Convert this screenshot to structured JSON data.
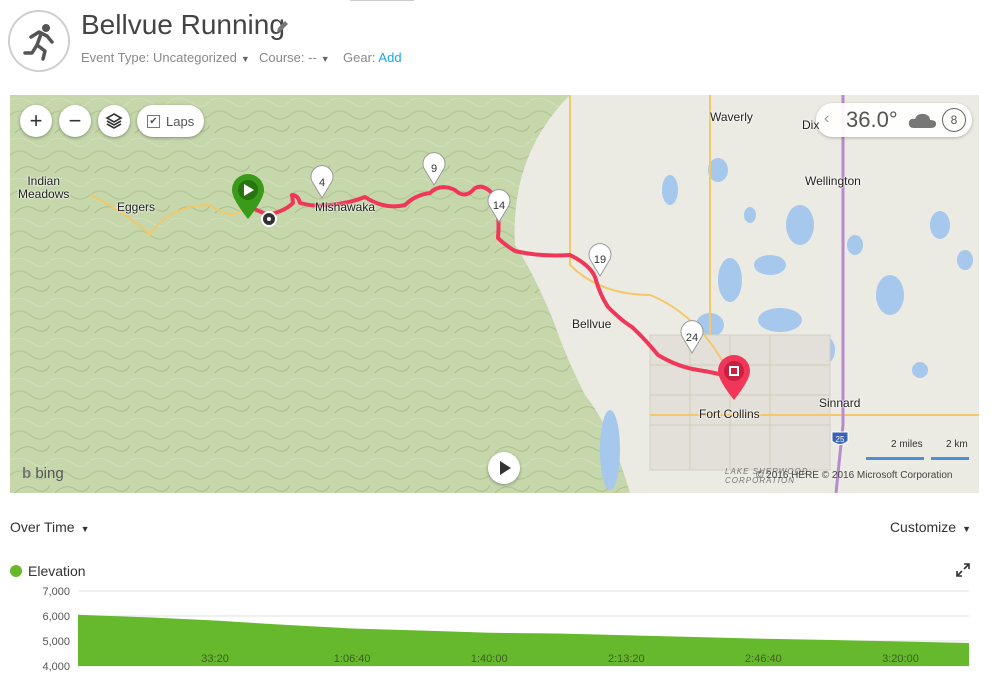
{
  "activity": {
    "title": "Bellvue Running",
    "event_type_label": "Event Type: Uncategorized",
    "course_label": "Course: --",
    "gear_label": "Gear:",
    "gear_link": "Add"
  },
  "map": {
    "laps_label": "Laps",
    "laps_checked": true,
    "weather": {
      "temperature": "36.0°",
      "wind": "8",
      "icon": "cloud-icon"
    },
    "labels": {
      "indian_meadows": "Indian\nMeadows",
      "eggers": "Eggers",
      "mishawaka": "Mishawaka",
      "waverly": "Waverly",
      "dixon": "Dix",
      "wellington": "Wellington",
      "bellvue": "Bellvue",
      "fort_collins": "Fort Collins",
      "sinnard": "Sinnard"
    },
    "lap_markers": [
      "4",
      "9",
      "14",
      "19",
      "24"
    ],
    "highway": "25",
    "watermark": "LAKE SHERWOOD\nCORPORATION",
    "copyright": "© 2016 HERE   © 2016 Microsoft Corporation",
    "scale_miles": "2 miles",
    "scale_km": "2 km",
    "provider": "bing",
    "colors": {
      "route": "#f0375a",
      "start": "#3a9a1a",
      "end": "#f0375a"
    }
  },
  "chart_toolbar": {
    "view_label": "Over Time",
    "customize_label": "Customize"
  },
  "chart_data": {
    "type": "area",
    "title": "",
    "series": [
      {
        "name": "Elevation",
        "color": "#66b82d"
      }
    ],
    "ylabel": "",
    "ylim": [
      4000,
      7000
    ],
    "yticks": [
      "4,000",
      "5,000",
      "6,000",
      "7,000"
    ],
    "xticks": [
      "33:20",
      "1:06:40",
      "1:40:00",
      "2:13:20",
      "2:46:40",
      "3:20:00"
    ],
    "x_seconds": [
      0,
      1000,
      2000,
      3000,
      4000,
      5000,
      6000,
      7000,
      8000,
      9000,
      10000,
      11000,
      12000,
      13000
    ],
    "values": [
      6050,
      5950,
      5820,
      5650,
      5500,
      5420,
      5330,
      5300,
      5230,
      5160,
      5090,
      5040,
      4980,
      4920
    ],
    "grid": true
  }
}
